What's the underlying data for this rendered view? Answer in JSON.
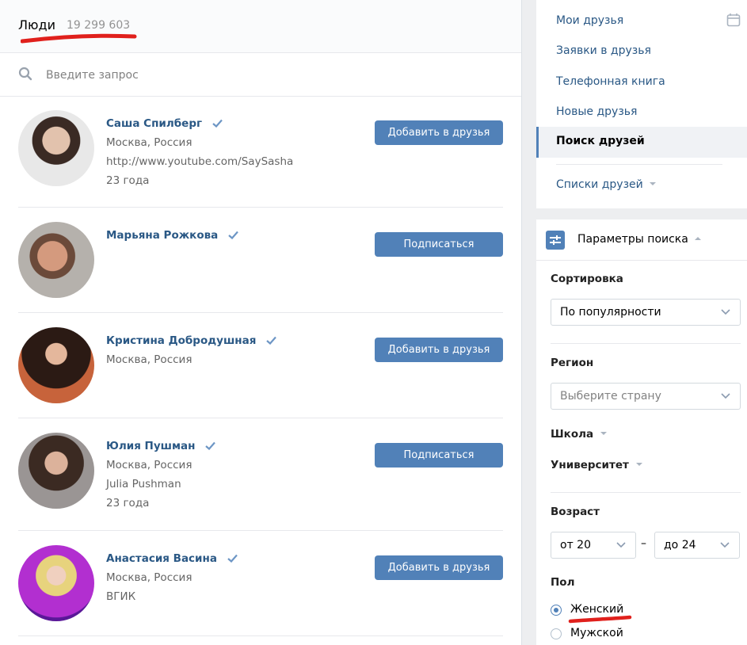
{
  "header": {
    "title": "Люди",
    "count": "19 299 603"
  },
  "search": {
    "placeholder": "Введите запрос"
  },
  "people": [
    {
      "name": "Саша Спилберг",
      "lines": [
        "Москва, Россия",
        "http://www.youtube.com/SaySasha",
        "23 года"
      ],
      "action": "Добавить в друзья"
    },
    {
      "name": "Марьяна Рожкова",
      "lines": [],
      "action": "Подписаться"
    },
    {
      "name": "Кристина Добродушная",
      "lines": [
        "Москва, Россия"
      ],
      "action": "Добавить в друзья"
    },
    {
      "name": "Юлия Пушман",
      "lines": [
        "Москва, Россия",
        "Julia Pushman",
        "23 года"
      ],
      "action": "Подписаться"
    },
    {
      "name": "Анастасия Васина",
      "lines": [
        "Москва, Россия",
        "ВГИК"
      ],
      "action": "Добавить в друзья"
    }
  ],
  "nav": {
    "items": [
      "Мои друзья",
      "Заявки в друзья",
      "Телефонная книга",
      "Новые друзья"
    ],
    "active": "Поиск друзей",
    "lists": "Списки друзей"
  },
  "params": {
    "title": "Параметры поиска",
    "sort_label": "Сортировка",
    "sort_value": "По популярности",
    "region_label": "Регион",
    "region_placeholder": "Выберите страну",
    "school_label": "Школа",
    "university_label": "Университет",
    "age_label": "Возраст",
    "age_from": "от 20",
    "age_dash": "–",
    "age_to": "до 24",
    "gender_label": "Пол",
    "gender_options": [
      "Женский",
      "Мужской"
    ],
    "gender_selected": "Женский"
  },
  "colors": {
    "accent": "#5181b8",
    "link": "#2a5885",
    "annotation": "#e0201c"
  },
  "icons": [
    "search-icon",
    "verified-check-icon",
    "calendar-icon",
    "params-icon",
    "chevron-down-icon"
  ]
}
